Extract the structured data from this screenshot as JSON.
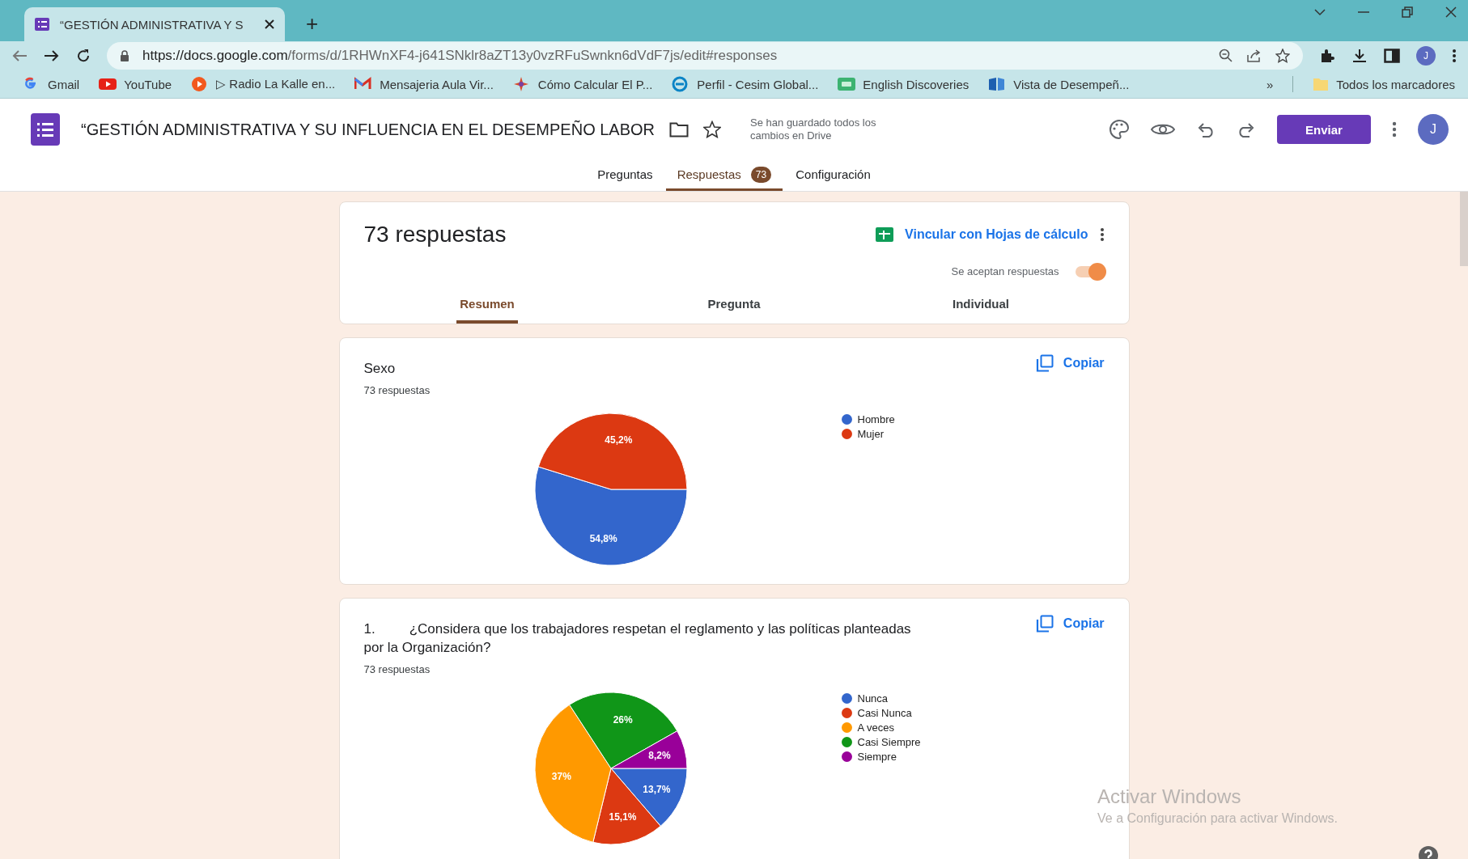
{
  "browser": {
    "tabs": [
      {
        "title": "“GESTIÓN ADMINISTRATIVA Y S",
        "selected": true
      }
    ],
    "new_tab": "+",
    "url_host": "https://docs.google.com",
    "url_path": "/forms/d/1RHWnXF4-j641SNklr8aZT13y0vzRFuSwnkn6dVdF7js/edit#responses",
    "profile_initial": "J",
    "bookmarks": [
      {
        "label": "Gmail"
      },
      {
        "label": "YouTube"
      },
      {
        "label": "▷ Radio La Kalle en..."
      },
      {
        "label": "Mensajeria Aula Vir..."
      },
      {
        "label": "Cómo Calcular El P..."
      },
      {
        "label": "Perfil - Cesim Global..."
      },
      {
        "label": "English Discoveries"
      },
      {
        "label": "Vista de Desempeñ..."
      }
    ],
    "overflow": "»",
    "all_bookmarks": "Todos los marcadores"
  },
  "form": {
    "title": "“GESTIÓN ADMINISTRATIVA Y SU INFLUENCIA EN EL DESEMPEÑO LABOR",
    "save_status": "Se han guardado todos los cambios en Drive",
    "send_button": "Enviar",
    "profile_initial": "J",
    "tabs": [
      {
        "label": "Preguntas",
        "selected": false
      },
      {
        "label": "Respuestas",
        "selected": true,
        "badge": "73"
      },
      {
        "label": "Configuración",
        "selected": false
      }
    ]
  },
  "summary": {
    "title": "73 respuestas",
    "link_sheets": "Vincular con Hojas de cálculo",
    "accepting_label": "Se aceptan respuestas",
    "accepting": true,
    "tabs": [
      {
        "label": "Resumen",
        "selected": true
      },
      {
        "label": "Pregunta",
        "selected": false
      },
      {
        "label": "Individual",
        "selected": false
      }
    ]
  },
  "questions": [
    {
      "title": "Sexo",
      "count": "73 respuestas",
      "copy": "Copiar",
      "chart_data": {
        "type": "pie",
        "categories": [
          "Hombre",
          "Mujer"
        ],
        "values": [
          54.8,
          45.2
        ],
        "colors": [
          "#3366cc",
          "#dc3912"
        ],
        "value_labels": [
          "54,8%",
          "45,2%"
        ]
      }
    },
    {
      "number": "1.",
      "title": "¿Considera que los trabajadores respetan el reglamento y las políticas planteadas por la Organización?",
      "count": "73 respuestas",
      "copy": "Copiar",
      "chart_data": {
        "type": "pie",
        "categories": [
          "Nunca",
          "Casi Nunca",
          "A veces",
          "Casi Siempre",
          "Siempre"
        ],
        "values": [
          13.7,
          15.1,
          37,
          26,
          8.2
        ],
        "colors": [
          "#3366cc",
          "#dc3912",
          "#ff9900",
          "#109618",
          "#990099"
        ],
        "value_labels": [
          "13,7%",
          "15,1%",
          "37%",
          "26%",
          "8,2%"
        ]
      }
    }
  ],
  "os_notice": {
    "title": "Activar Windows",
    "text": "Ve a Configuración para activar Windows."
  }
}
